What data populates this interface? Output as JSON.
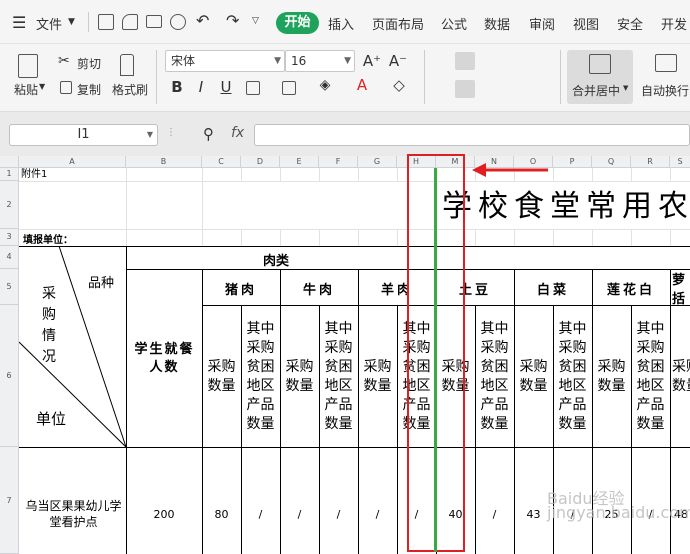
{
  "menu": {
    "file": "文件",
    "tabs": [
      "开始",
      "插入",
      "页面布局",
      "公式",
      "数据",
      "审阅",
      "视图",
      "安全",
      "开发"
    ]
  },
  "toolbar": {
    "paste": "粘贴",
    "cut": "剪切",
    "copy": "复制",
    "format_painter": "格式刷",
    "font_name": "宋体",
    "font_size": "16",
    "merge_center": "合并居中",
    "auto_wrap": "自动换行"
  },
  "formula_bar": {
    "name_box": "I1",
    "fx": "fx"
  },
  "columns": [
    "A",
    "B",
    "C",
    "D",
    "E",
    "F",
    "G",
    "H",
    "M",
    "N",
    "O",
    "P",
    "Q",
    "R",
    "S"
  ],
  "rows": [
    "1",
    "2",
    "3",
    "4",
    "5",
    "6",
    "7"
  ],
  "sheet": {
    "a1": "附件1",
    "title": "学校食堂常用农",
    "fill_unit": "填报单位：",
    "diag_top": "品种",
    "diag_mid": "采\n购\n情\n况",
    "diag_bottom": "单位",
    "student_count_hdr": "学生就餐\n人数",
    "meat": "肉类",
    "pork": "猪肉",
    "beef": "牛肉",
    "mutton": "羊肉",
    "potato": "土豆",
    "cabbage": "白菜",
    "cauliflower": "莲花白",
    "radish": "萝\n括",
    "buy_qty": "采购\n数量",
    "poor_qty": "其中\n采购\n贫困\n地区\n产品\n数量",
    "school": "乌当区果果幼儿学\n堂看护点",
    "values": [
      "200",
      "80",
      "/",
      "/",
      "/",
      "/",
      "/",
      "40",
      "/",
      "43",
      "/",
      "25",
      "/",
      "48"
    ]
  },
  "watermark": "Baidu经验\njingyan.baidu.com",
  "colors": {
    "accent": "#1fa35c",
    "highlight_red": "#e02020",
    "green_line": "#3aa845"
  }
}
